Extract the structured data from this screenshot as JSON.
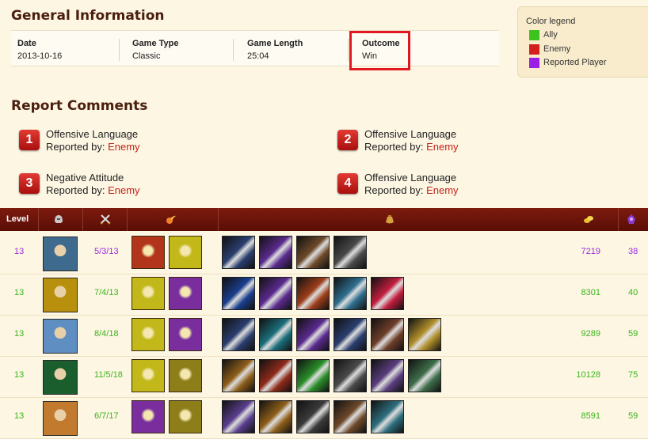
{
  "general": {
    "title": "General Information",
    "fields": [
      {
        "label": "Date",
        "value": "2013-10-16"
      },
      {
        "label": "Game Type",
        "value": "Classic"
      },
      {
        "label": "Game Length",
        "value": "25:04"
      },
      {
        "label": "Outcome",
        "value": "Win"
      }
    ]
  },
  "legend": {
    "title": "Color legend",
    "items": [
      {
        "label": "Ally",
        "color": "#3cc31d"
      },
      {
        "label": "Enemy",
        "color": "#d41f1f"
      },
      {
        "label": "Reported Player",
        "color": "#9b1ee6"
      }
    ]
  },
  "comments": {
    "title": "Report Comments",
    "reported_by_label": "Reported by:",
    "items": [
      {
        "number": "1",
        "reason": "Offensive Language",
        "by": "Enemy"
      },
      {
        "number": "2",
        "reason": "Offensive Language",
        "by": "Enemy"
      },
      {
        "number": "3",
        "reason": "Negative Attitude",
        "by": "Enemy"
      },
      {
        "number": "4",
        "reason": "Offensive Language",
        "by": "Enemy"
      }
    ]
  },
  "table": {
    "header": {
      "level": "Level",
      "champion_icon": "helmet-icon",
      "kda_icon": "crossed-swords-icon",
      "spells_icon": "fireball-icon",
      "items_icon": "pouch-icon",
      "gold_icon": "gold-coins-icon",
      "cs_icon": "minion-icon"
    },
    "rows": [
      {
        "level": "13",
        "kda": "5/3/13",
        "gold": "7219",
        "cs": "38",
        "color": "purple",
        "portrait": "#3e6a8e",
        "spells": [
          "#b2341a",
          "#c2b81a"
        ],
        "items": [
          "#2a3e6e",
          "#5a2a8e",
          "#6e4a2a",
          "#4a4a4a"
        ]
      },
      {
        "level": "13",
        "kda": "7/4/13",
        "gold": "8301",
        "cs": "40",
        "color": "green",
        "portrait": "#b8900e",
        "spells": [
          "#c2b81a",
          "#7a2e9e"
        ],
        "items": [
          "#1a3e8e",
          "#5a2a8e",
          "#9e3e1a",
          "#2e6e8e",
          "#c21e3e"
        ]
      },
      {
        "level": "13",
        "kda": "8/4/18",
        "gold": "9289",
        "cs": "59",
        "color": "green",
        "portrait": "#5e8ec2",
        "spells": [
          "#c2b81a",
          "#7a2e9e"
        ],
        "items": [
          "#2a3e6e",
          "#1a6e7a",
          "#5a2a8e",
          "#2a3e6e",
          "#6e3e2a",
          "#b08e2a"
        ]
      },
      {
        "level": "13",
        "kda": "11/5/18",
        "gold": "10128",
        "cs": "75",
        "color": "green",
        "portrait": "#1a5e2e",
        "spells": [
          "#c2b81a",
          "#8e7e1a"
        ],
        "items": [
          "#8e5e1a",
          "#8e2a1a",
          "#2a8e2a",
          "#4a4a4a",
          "#5a3e7e",
          "#3e6e4a"
        ]
      },
      {
        "level": "13",
        "kda": "6/7/17",
        "gold": "8591",
        "cs": "59",
        "color": "green",
        "portrait": "#c27a2e",
        "spells": [
          "#7a2e9e",
          "#8e7e1a"
        ],
        "items": [
          "#5a3e8e",
          "#8e5e1a",
          "#3a3a3a",
          "#6e4a2a",
          "#2e6e7e"
        ]
      }
    ]
  }
}
